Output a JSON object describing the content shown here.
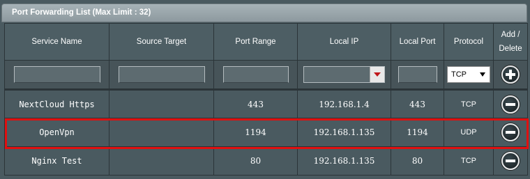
{
  "panel": {
    "title": "Port Forwarding List (Max Limit : 32)"
  },
  "columns": {
    "service_name": "Service Name",
    "source_target": "Source Target",
    "port_range": "Port Range",
    "local_ip": "Local IP",
    "local_port": "Local Port",
    "protocol": "Protocol",
    "add_delete_line1": "Add /",
    "add_delete_line2": "Delete"
  },
  "new_entry": {
    "service_name": "",
    "source_target": "",
    "port_range": "",
    "local_ip": "",
    "local_port": "",
    "protocol": "TCP",
    "add_icon": "plus-circle-icon"
  },
  "rules": [
    {
      "service_name": "NextCloud Https",
      "source_target": "",
      "port_range": "443",
      "local_ip": "192.168.1.4",
      "local_port": "443",
      "protocol": "TCP",
      "delete_icon": "minus-circle-icon"
    },
    {
      "service_name": "OpenVpn",
      "source_target": "",
      "port_range": "1194",
      "local_ip": "192.168.1.135",
      "local_port": "1194",
      "protocol": "UDP",
      "delete_icon": "minus-circle-icon"
    },
    {
      "service_name": "Nginx Test",
      "source_target": "",
      "port_range": "80",
      "local_ip": "192.168.1.135",
      "local_port": "80",
      "protocol": "TCP",
      "delete_icon": "minus-circle-icon"
    }
  ],
  "colors": {
    "highlight": "#e01010",
    "panel_bg": "#4a5a60",
    "dropdown_arrow": "#c0161a"
  }
}
